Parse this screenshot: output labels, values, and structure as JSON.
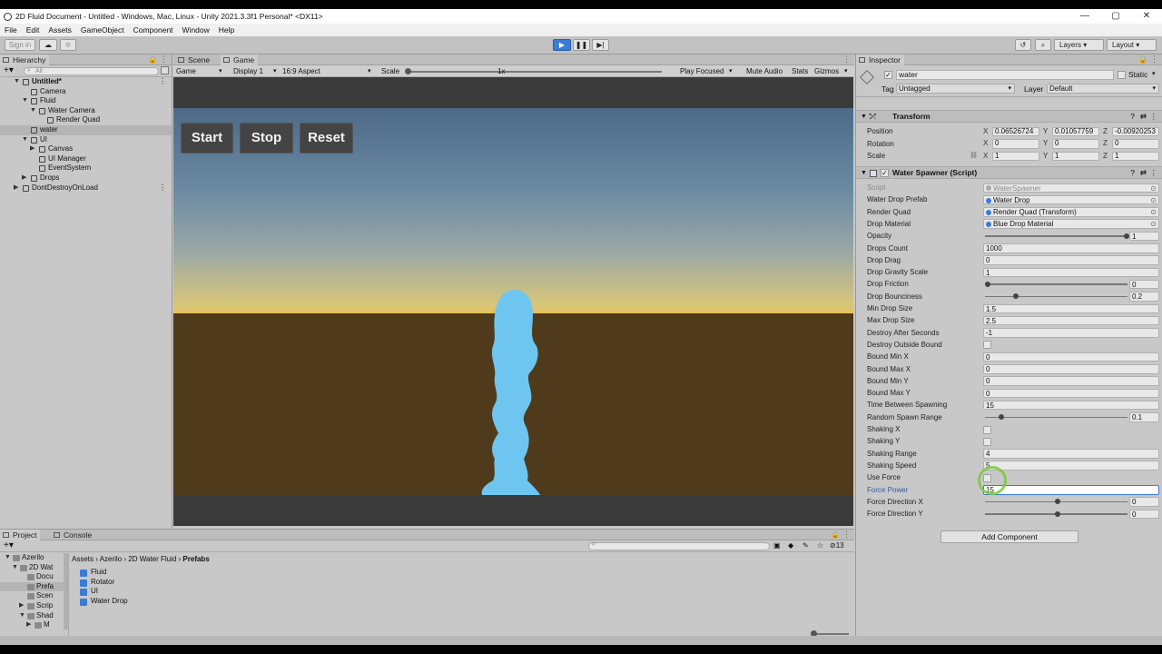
{
  "window": {
    "title": "2D Fluid Document - Untitled - Windows, Mac, Linux - Unity 2021.3.3f1 Personal* <DX11>",
    "controls": [
      "—",
      "▢",
      "✕"
    ]
  },
  "menu": [
    "File",
    "Edit",
    "Assets",
    "GameObject",
    "Component",
    "Window",
    "Help"
  ],
  "toolbar": {
    "sign_in": "Sign in",
    "layers": "Layers",
    "layout": "Layout"
  },
  "hierarchy": {
    "tab": "Hierarchy",
    "search_placeholder": "All",
    "items": [
      {
        "label": "Untitled*",
        "depth": 0,
        "expanded": true,
        "bold": true,
        "selected": false
      },
      {
        "label": "Camera",
        "depth": 1,
        "expanded": null,
        "bold": false,
        "selected": false
      },
      {
        "label": "Fluid",
        "depth": 1,
        "expanded": true,
        "bold": false,
        "selected": false
      },
      {
        "label": "Water Camera",
        "depth": 2,
        "expanded": true,
        "bold": false,
        "selected": false
      },
      {
        "label": "Render Quad",
        "depth": 3,
        "expanded": null,
        "bold": false,
        "selected": false
      },
      {
        "label": "water",
        "depth": 1,
        "expanded": null,
        "bold": false,
        "selected": true
      },
      {
        "label": "UI",
        "depth": 1,
        "expanded": true,
        "bold": false,
        "selected": false
      },
      {
        "label": "Canvas",
        "depth": 2,
        "expanded": false,
        "bold": false,
        "selected": false
      },
      {
        "label": "UI Manager",
        "depth": 2,
        "expanded": null,
        "bold": false,
        "selected": false
      },
      {
        "label": "EventSystem",
        "depth": 2,
        "expanded": null,
        "bold": false,
        "selected": false
      },
      {
        "label": "Drops",
        "depth": 1,
        "expanded": false,
        "bold": false,
        "selected": false
      },
      {
        "label": "DontDestroyOnLoad",
        "depth": 0,
        "expanded": false,
        "bold": false,
        "selected": false
      }
    ]
  },
  "scene_tabs": {
    "scene": "Scene",
    "game": "Game"
  },
  "game_bar": {
    "mode": "Game",
    "display": "Display 1",
    "aspect": "16:9 Aspect",
    "scale_label": "Scale",
    "scale_value": "1x",
    "play_focused": "Play Focused",
    "mute": "Mute Audio",
    "stats": "Stats",
    "gizmos": "Gizmos"
  },
  "game_ui": {
    "start": "Start",
    "stop": "Stop",
    "reset": "Reset"
  },
  "inspector": {
    "tab": "Inspector",
    "object_name": "water",
    "static_label": "Static",
    "tag_label": "Tag",
    "tag_value": "Untagged",
    "layer_label": "Layer",
    "layer_value": "Default",
    "transform": {
      "title": "Transform",
      "rows": [
        {
          "label": "Position",
          "x": "0.06526724",
          "y": "0.01057759",
          "z": "-0.00920253"
        },
        {
          "label": "Rotation",
          "x": "0",
          "y": "0",
          "z": "0"
        },
        {
          "label": "Scale",
          "x": "1",
          "y": "1",
          "z": "1"
        }
      ]
    },
    "script_component": {
      "title": "Water Spawner (Script)",
      "rows": [
        {
          "label": "Script",
          "kind": "ref",
          "value": "WaterSpawner",
          "dim": true
        },
        {
          "label": "Water Drop Prefab",
          "kind": "ref",
          "value": "Water Drop"
        },
        {
          "label": "Render Quad",
          "kind": "ref",
          "value": "Render Quad (Transform)"
        },
        {
          "label": "Drop Material",
          "kind": "ref",
          "value": "Blue Drop Material"
        },
        {
          "label": "Opacity",
          "kind": "slider",
          "value": "1",
          "level": 1.0
        },
        {
          "label": "Drops Count",
          "kind": "field",
          "value": "1000"
        },
        {
          "label": "Drop Drag",
          "kind": "field",
          "value": "0"
        },
        {
          "label": "Drop Gravity Scale",
          "kind": "field",
          "value": "1"
        },
        {
          "label": "Drop Friction",
          "kind": "slider",
          "value": "0",
          "level": 0.0
        },
        {
          "label": "Drop Bounciness",
          "kind": "slider",
          "value": "0.2",
          "level": 0.2
        },
        {
          "label": "Min Drop Size",
          "kind": "field",
          "value": "1.5"
        },
        {
          "label": "Max Drop Size",
          "kind": "field",
          "value": "2.5"
        },
        {
          "label": "Destroy After Seconds",
          "kind": "field",
          "value": "-1"
        },
        {
          "label": "Destroy Outside Bound",
          "kind": "check",
          "value": ""
        },
        {
          "label": "Bound Min X",
          "kind": "field",
          "value": "0"
        },
        {
          "label": "Bound Max X",
          "kind": "field",
          "value": "0"
        },
        {
          "label": "Bound Min Y",
          "kind": "field",
          "value": "0"
        },
        {
          "label": "Bound Max Y",
          "kind": "field",
          "value": "0"
        },
        {
          "label": "Time Between Spawning",
          "kind": "field",
          "value": "15"
        },
        {
          "label": "Random Spawn Range",
          "kind": "slider",
          "value": "0.1",
          "level": 0.1
        },
        {
          "label": "Shaking X",
          "kind": "check",
          "value": ""
        },
        {
          "label": "Shaking Y",
          "kind": "check",
          "value": ""
        },
        {
          "label": "Shaking Range",
          "kind": "field",
          "value": "4"
        },
        {
          "label": "Shaking Speed",
          "kind": "field",
          "value": "5"
        },
        {
          "label": "Use Force",
          "kind": "check",
          "value": ""
        },
        {
          "label": "Force Power",
          "kind": "field",
          "value": "15",
          "focused": true
        },
        {
          "label": "Force Direction X",
          "kind": "slider",
          "value": "0",
          "level": 0.5
        },
        {
          "label": "Force Direction Y",
          "kind": "slider",
          "value": "0",
          "level": 0.5
        }
      ]
    },
    "add_component": "Add Component"
  },
  "project": {
    "tab_project": "Project",
    "tab_console": "Console",
    "count": "13",
    "breadcrumb": [
      "Assets",
      "Azerilo",
      "2D Water Fluid",
      "Prefabs"
    ],
    "tree": [
      "Azerilo",
      "2D Wat",
      "Docu",
      "Prefa",
      "Scen",
      "Scrip",
      "Shad",
      "M"
    ],
    "assets": [
      "Fluid",
      "Rotator",
      "UI",
      "Water Drop"
    ]
  },
  "colors": {
    "water": "#6ec6f0",
    "ground": "#4f3a1c",
    "play_active": "#3a7bd5"
  }
}
